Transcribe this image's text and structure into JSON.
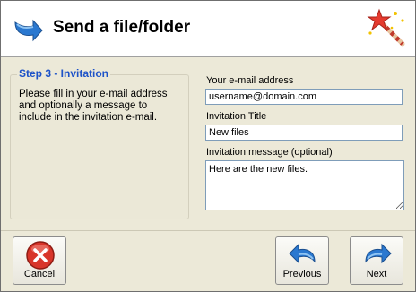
{
  "header": {
    "title": "Send a file/folder",
    "icon": "send-arrow-icon",
    "wizard_icon": "magic-wand-icon"
  },
  "step": {
    "title": "Step 3 - Invitation",
    "description": "Please fill in your e-mail address and optionally a message to include in the invitation e-mail."
  },
  "form": {
    "email_label": "Your e-mail address",
    "email_value": "username@domain.com",
    "title_label": "Invitation Title",
    "title_value": "New files",
    "message_label": "Invitation message (optional)",
    "message_value": "Here are the new files."
  },
  "buttons": {
    "cancel": "Cancel",
    "previous": "Previous",
    "next": "Next"
  },
  "colors": {
    "step_title": "#1e53c8",
    "arrow_blue": "#2a78d0",
    "cancel_red": "#d8352a"
  }
}
